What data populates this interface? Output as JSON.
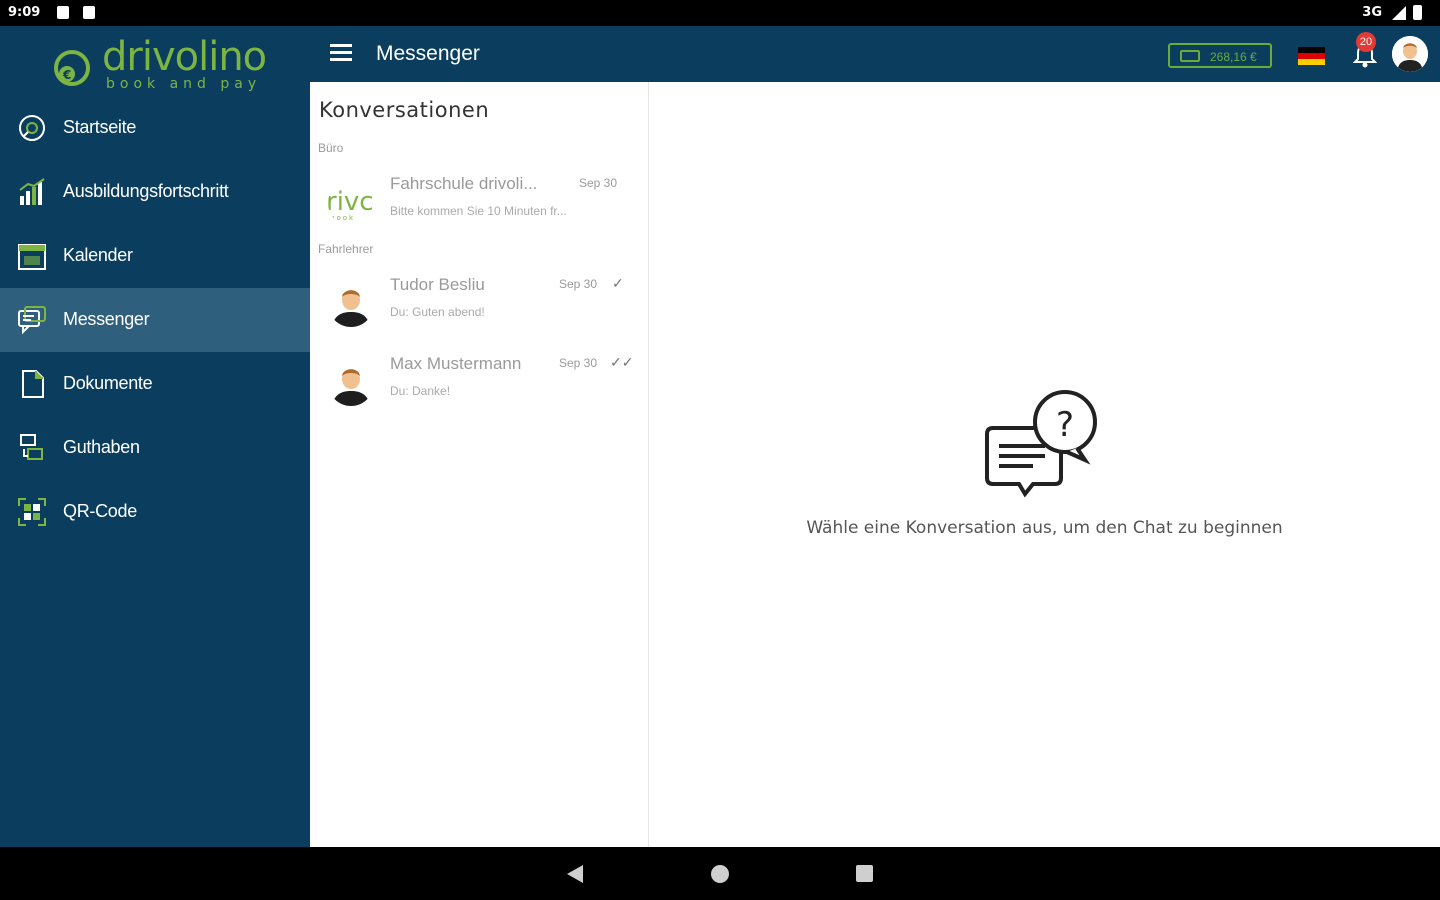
{
  "status_bar": {
    "time": "9:09",
    "network": "3G"
  },
  "brand": {
    "name": "drivolino",
    "tagline": "book and pay",
    "accent": "#7db543"
  },
  "sidebar": {
    "background": "#0b3e5e",
    "items": [
      {
        "label": "Startseite",
        "icon": "home-icon",
        "active": false
      },
      {
        "label": "Ausbildungsfortschritt",
        "icon": "progress-chart-icon",
        "active": false
      },
      {
        "label": "Kalender",
        "icon": "calendar-icon",
        "active": false
      },
      {
        "label": "Messenger",
        "icon": "chat-icon",
        "active": true
      },
      {
        "label": "Dokumente",
        "icon": "document-icon",
        "active": false
      },
      {
        "label": "Guthaben",
        "icon": "credit-icon",
        "active": false
      },
      {
        "label": "QR-Code",
        "icon": "qr-code-icon",
        "active": false
      }
    ]
  },
  "appbar": {
    "title": "Messenger",
    "balance": "268,16 €",
    "notification_count": "20",
    "language": "Deutsch"
  },
  "conversations": {
    "title": "Konversationen",
    "sections": [
      {
        "label": "Büro",
        "items": [
          {
            "name": "Fahrschule drivoli...",
            "date": "Sep 30",
            "preview": "Bitte kommen Sie 10 Minuten fr...",
            "status": ""
          }
        ]
      },
      {
        "label": "Fahrlehrer",
        "items": [
          {
            "name": "Tudor Besliu",
            "date": "Sep 30",
            "preview": "Du: Guten abend!",
            "status": "✓"
          },
          {
            "name": "Max Mustermann",
            "date": "Sep 30",
            "preview": "Du: Danke!",
            "status": "✓✓"
          }
        ]
      }
    ]
  },
  "main": {
    "empty_text": "Wähle eine Konversation aus, um den Chat zu beginnen",
    "empty_icon": "chat-question-icon"
  }
}
